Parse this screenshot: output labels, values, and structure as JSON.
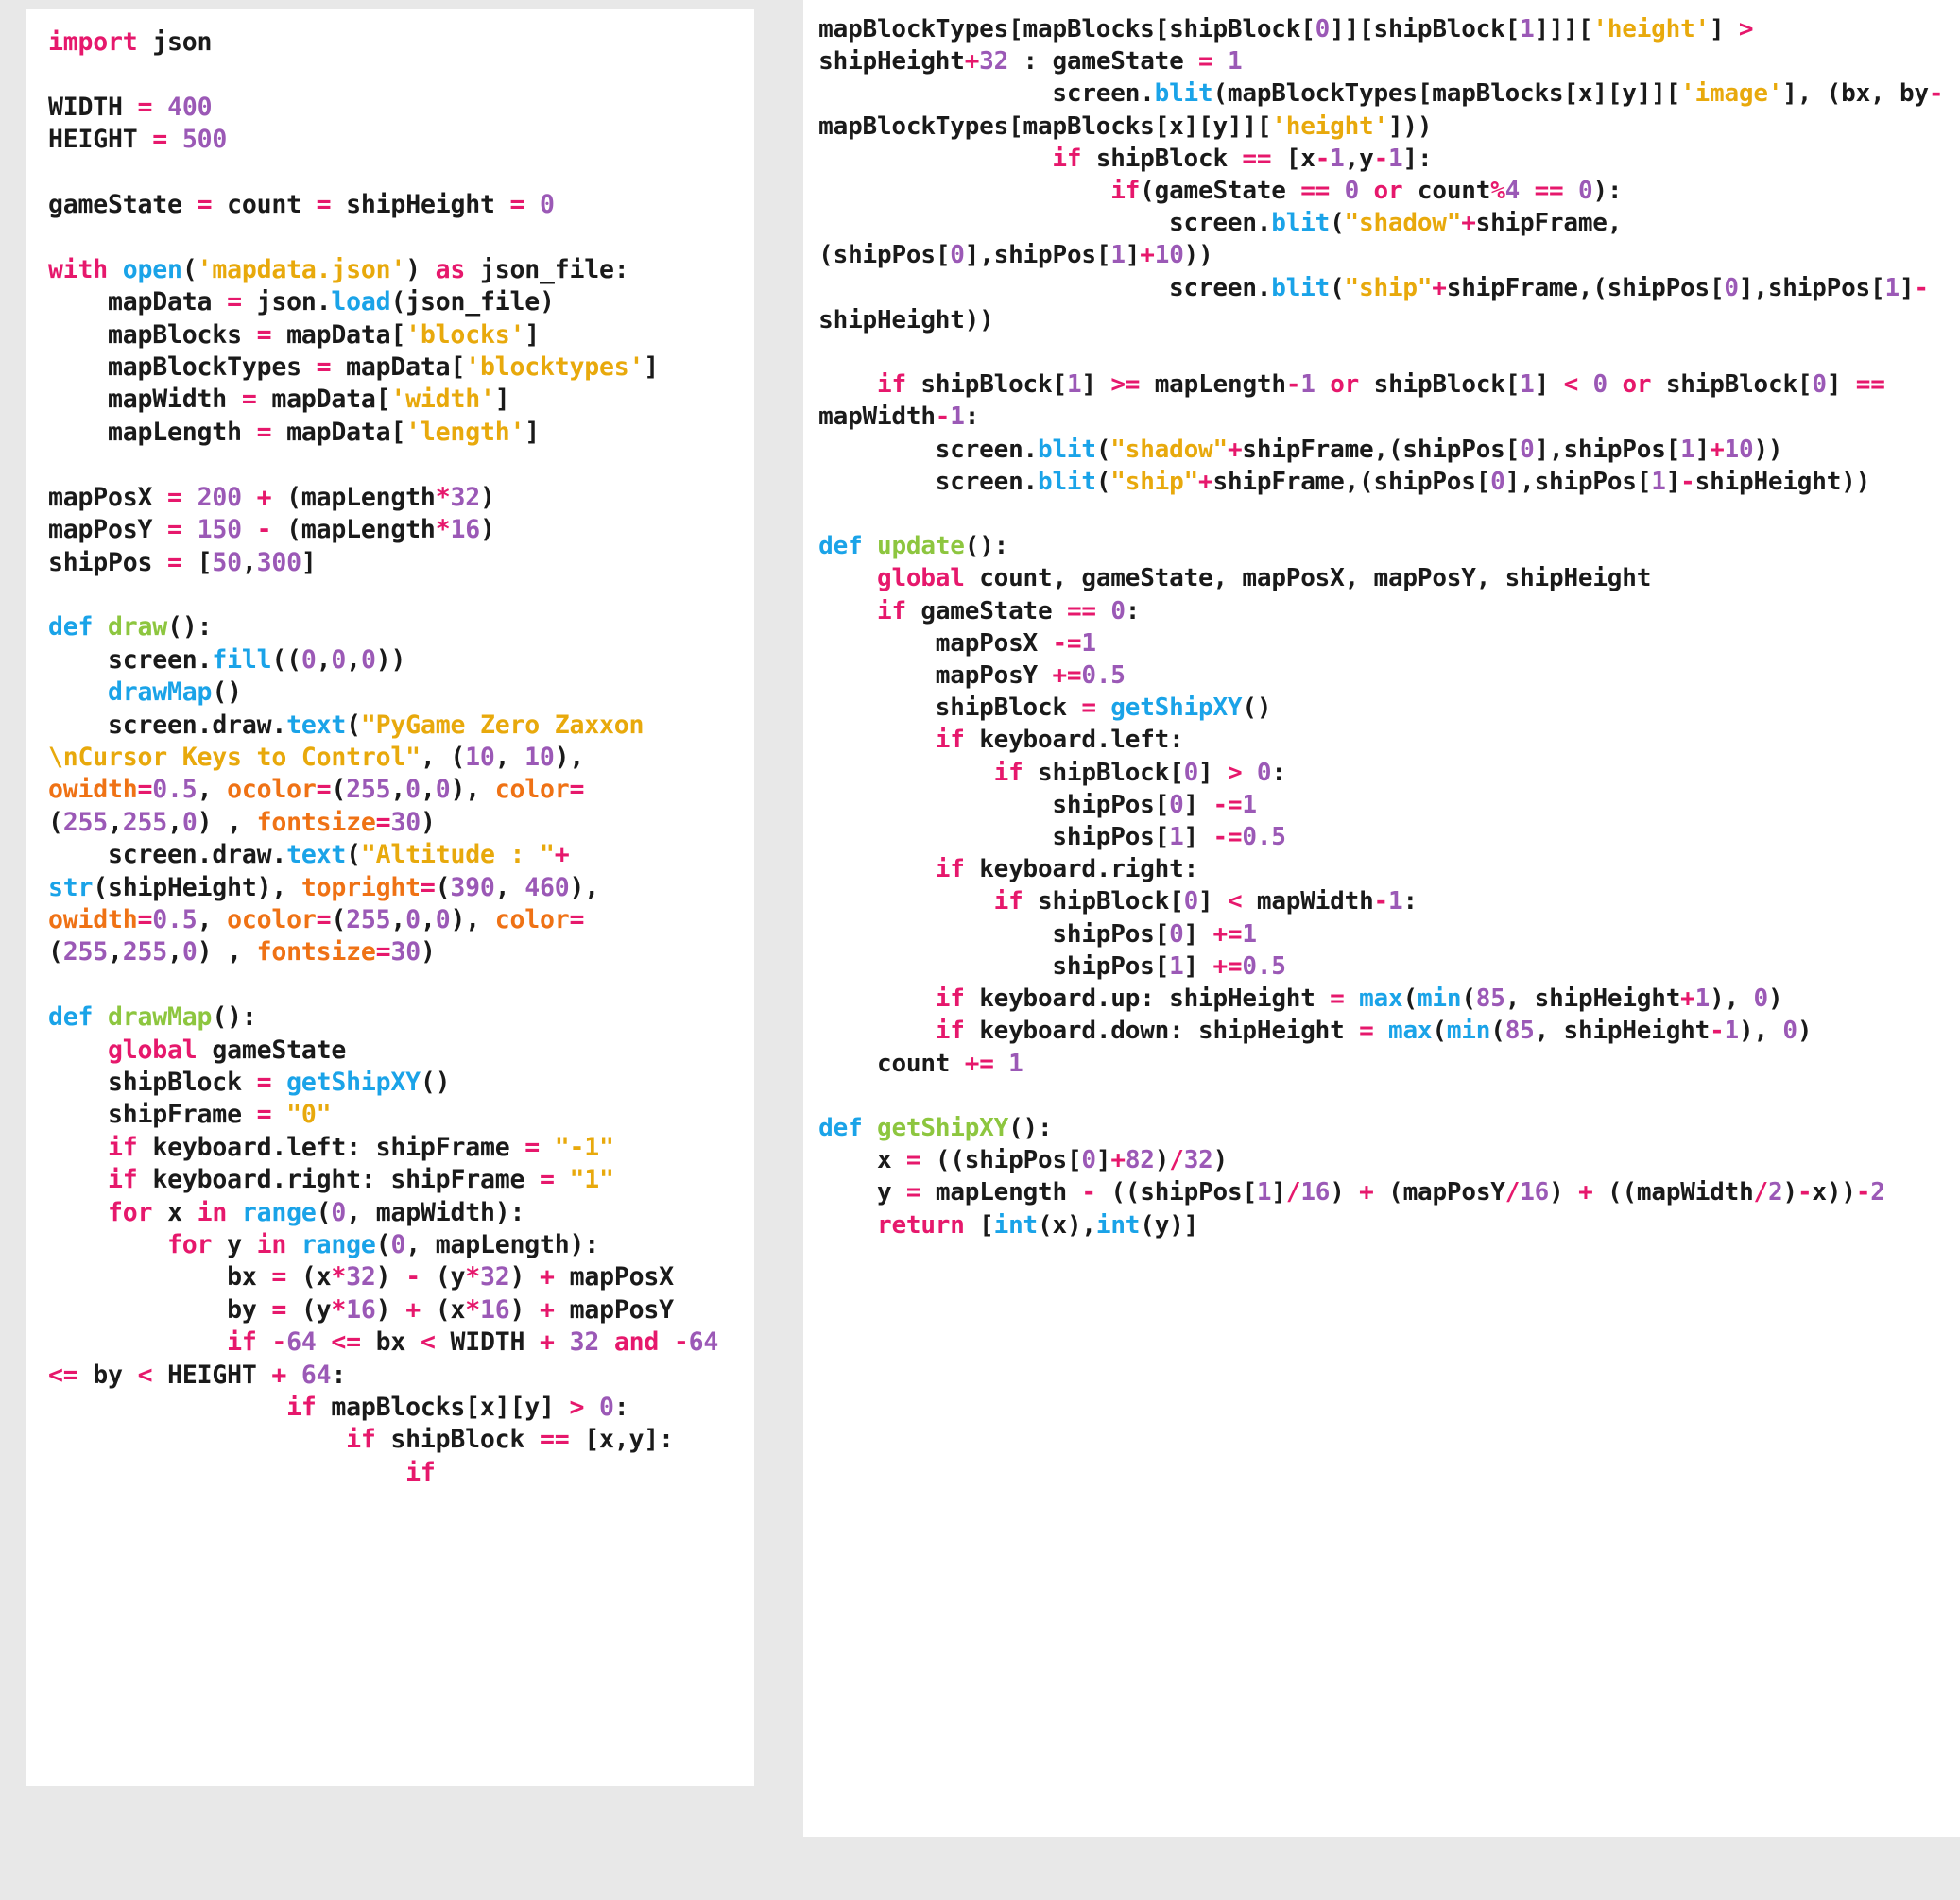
{
  "document": {
    "kind": "source-code-screenshot",
    "language": "Python",
    "program_title": "PyGame Zero Zaxxon",
    "background_color": "#e8e8e8",
    "panel_color": "#ffffff",
    "syntax_colors": {
      "keyword": "#e6186c",
      "function_name": "#8dc63f",
      "builtin": "#1aa3e8",
      "number": "#9b59b6",
      "operator": "#e6186c",
      "string": "#e8a90c",
      "keyword_argument": "#ef7215",
      "plain_text": "#1a1a1a"
    }
  },
  "columns": {
    "left": {
      "name": "left-code-column",
      "lines": [
        "import json",
        "",
        "WIDTH = 400",
        "HEIGHT = 500",
        "",
        "gameState = count = shipHeight = 0",
        "",
        "with open('mapdata.json') as json_file:",
        "    mapData = json.load(json_file)",
        "    mapBlocks = mapData['blocks']",
        "    mapBlockTypes = mapData['blocktypes']",
        "    mapWidth = mapData['width']",
        "    mapLength = mapData['length']",
        "",
        "mapPosX = 200 + (mapLength*32)",
        "mapPosY = 150 - (mapLength*16)",
        "shipPos = [50,300]",
        "",
        "def draw():",
        "    screen.fill((0,0,0))",
        "    drawMap()",
        "    screen.draw.text(\"PyGame Zero Zaxxon \\nCursor Keys to Control\", (10, 10), owidth=0.5, ocolor=(255,0,0), color=(255,255,0) , fontsize=30)",
        "    screen.draw.text(\"Altitude : \"+ str(shipHeight), topright=(390, 460), owidth=0.5, ocolor=(255,0,0), color=(255,255,0) , fontsize=30)",
        "",
        "def drawMap():",
        "    global gameState",
        "    shipBlock = getShipXY()",
        "    shipFrame = \"0\"",
        "    if keyboard.left: shipFrame = \"-1\"",
        "    if keyboard.right: shipFrame = \"1\"",
        "    for x in range(0, mapWidth):",
        "        for y in range(0, mapLength):",
        "            bx = (x*32) - (y*32) + mapPosX",
        "            by = (y*16) + (x*16) + mapPosY",
        "            if -64 <= bx < WIDTH + 32 and -64 <= by < HEIGHT + 64:",
        "                if mapBlocks[x][y] > 0:",
        "                    if shipBlock == [x,y]:",
        "                        if"
      ]
    },
    "right": {
      "name": "right-code-column",
      "lines": [
        "mapBlockTypes[mapBlocks[shipBlock[0]][shipBlock[1]]]['height'] > shipHeight+32 : gameState = 1",
        "                screen.blit(mapBlockTypes[mapBlocks[x][y]]['image'], (bx, by-mapBlockTypes[mapBlocks[x][y]]['height']))",
        "                if shipBlock == [x-1,y-1]:",
        "                    if(gameState == 0 or count%4 == 0):",
        "                        screen.blit(\"shadow\"+shipFrame,(shipPos[0],shipPos[1]+10))",
        "                        screen.blit(\"ship\"+shipFrame,(shipPos[0],shipPos[1]-shipHeight))",
        "",
        "    if shipBlock[1] >= mapLength-1 or shipBlock[1] < 0 or shipBlock[0] == mapWidth-1:",
        "        screen.blit(\"shadow\"+shipFrame,(shipPos[0],shipPos[1]+10))",
        "        screen.blit(\"ship\"+shipFrame,(shipPos[0],shipPos[1]-shipHeight))",
        "",
        "def update():",
        "    global count, gameState, mapPosX, mapPosY, shipHeight",
        "    if gameState == 0:",
        "        mapPosX -=1",
        "        mapPosY +=0.5",
        "        shipBlock = getShipXY()",
        "        if keyboard.left:",
        "            if shipBlock[0] > 0:",
        "                shipPos[0] -=1",
        "                shipPos[1] -=0.5",
        "        if keyboard.right:",
        "            if shipBlock[0] < mapWidth-1:",
        "                shipPos[0] +=1",
        "                shipPos[1] +=0.5",
        "        if keyboard.up: shipHeight = max(min(85, shipHeight+1), 0)",
        "        if keyboard.down: shipHeight = max(min(85, shipHeight-1), 0)",
        "    count += 1",
        "",
        "def getShipXY():",
        "    x = ((shipPos[0]+82)/32)",
        "    y = mapLength - ((shipPos[1]/16) + (mapPosY/16) + ((mapWidth/2)-x))-2",
        "    return [int(x),int(y)]"
      ]
    }
  }
}
